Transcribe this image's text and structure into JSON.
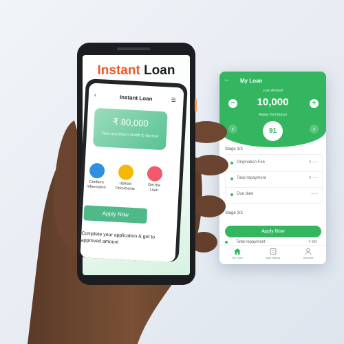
{
  "colors": {
    "accent_green": "#33b65f",
    "orange": "#ef5a28"
  },
  "right_screen": {
    "title": "My Loan",
    "back_icon": "arrow-left-icon",
    "amount_label": "Loan Amount",
    "amount": "10,000",
    "minus_label": "−",
    "plus_label": "+",
    "term_label": "Repay Term(days)",
    "term_value": "91",
    "stage1_label": "Stage 1/3",
    "rows": [
      {
        "label": "Origination Fee",
        "value": "₹ -----"
      },
      {
        "label": "Total repayment",
        "value": "₹ -----"
      },
      {
        "label": "Due date",
        "value": "------"
      }
    ],
    "stage2_label": "Stage 2/3",
    "apply_label": "Apply Now",
    "partial_row": {
      "label": "Total repayment",
      "value": "₹ 980"
    },
    "nav": [
      {
        "label": "My Loan",
        "icon": "home-icon"
      },
      {
        "label": "loan history",
        "icon": "history-icon"
      },
      {
        "label": "Account",
        "icon": "account-icon"
      }
    ]
  },
  "left_screen": {
    "headline_word1": "Instant",
    "headline_word2": "Loan",
    "inner": {
      "title": "Instant Loan",
      "credit_amount": "₹ 80,000",
      "credit_sub": "Your maximum credit to borrow",
      "steps": [
        {
          "label": "Conform\nInformation",
          "color": "#2f8fe0"
        },
        {
          "label": "Upload\nDocuments",
          "color": "#f5b800"
        },
        {
          "label": "Get the\nLoan",
          "color": "#f05a6a"
        }
      ],
      "apply_label": "Apply Now",
      "footer_text": "Complete your application & get to approved amount"
    }
  }
}
